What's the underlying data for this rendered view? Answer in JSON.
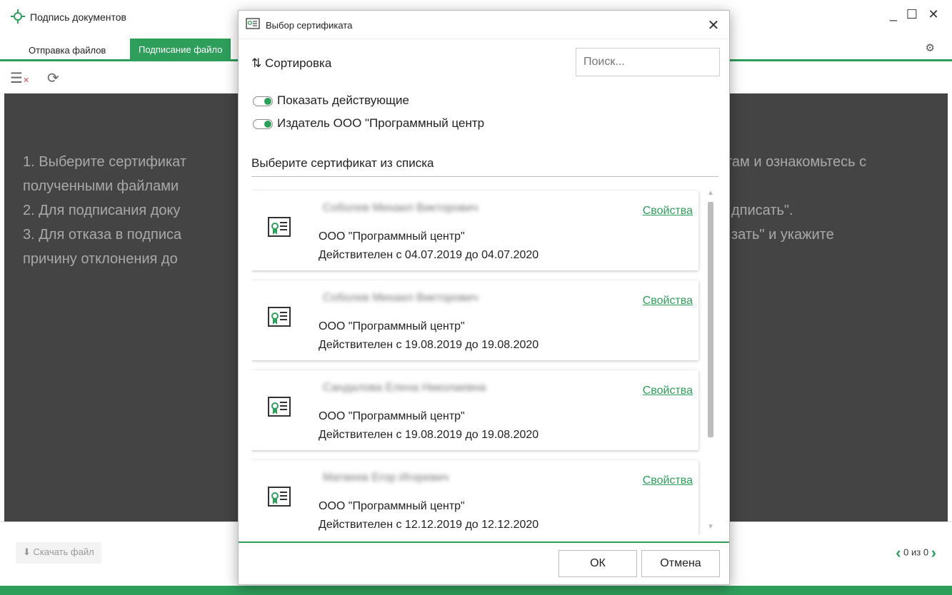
{
  "window": {
    "title": "Подпись документов",
    "tabs": [
      {
        "label": "Отправка файлов"
      },
      {
        "label": "Подписание файло"
      }
    ],
    "controls": {
      "minimize": "_",
      "maximize": "☐",
      "close": "✕"
    },
    "instructions": [
      "1. Выберите сертификат",
      "там и ознакомьтесь с",
      "полученными файлами",
      "2. Для подписания доку",
      "дписать\".",
      "3. Для отказа в подписа",
      "зать\" и укажите",
      "причину отклонения до"
    ],
    "download_label": "Скачать файл",
    "pager": "0 из 0",
    "accent_color": "#2e9e5b"
  },
  "dialog": {
    "title": "Выбор сертификата",
    "sort_label": "Сортировка",
    "search_placeholder": "Поиск...",
    "toggles": [
      {
        "label": "Показать действующие",
        "on": true
      },
      {
        "label": "Издатель ООО \"Программный центр",
        "on": true
      }
    ],
    "list_title": "Выберите сертификат из списка",
    "certificates": [
      {
        "name": "Соболев Михаил Викторович",
        "props_label": "Свойства",
        "org": "ООО \"Программный центр\"",
        "validity": "Действителен с 04.07.2019 до 04.07.2020"
      },
      {
        "name": "Соболев Михаил Викторович",
        "props_label": "Свойства",
        "org": "ООО \"Программный центр\"",
        "validity": "Действителен с 19.08.2019 до 19.08.2020"
      },
      {
        "name": "Сандалова Елена Николаевна",
        "props_label": "Свойства",
        "org": "ООО \"Программный центр\"",
        "validity": "Действителен с 19.08.2019 до 19.08.2020"
      },
      {
        "name": "Матвеев Егор Игоревич",
        "props_label": "Свойства",
        "org": "ООО \"Программный центр\"",
        "validity": "Действителен с 12.12.2019 до 12.12.2020"
      }
    ],
    "ok_label": "ОК",
    "cancel_label": "Отмена"
  }
}
